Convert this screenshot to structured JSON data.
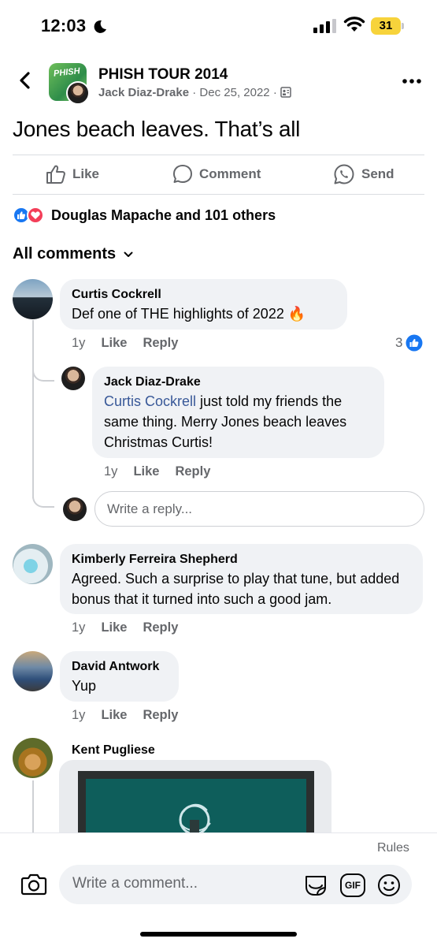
{
  "status_bar": {
    "time": "12:03",
    "battery": "31"
  },
  "post": {
    "group_name": "PHISH TOUR 2014",
    "group_avatar_text": "PHISH",
    "author": "Jack Diaz-Drake",
    "date": "Dec 25, 2022",
    "meta_sep": "·",
    "text": "Jones beach leaves. That’s all"
  },
  "actions": {
    "like": "Like",
    "comment": "Comment",
    "send": "Send"
  },
  "reactions": {
    "summary": "Douglas Mapache and 101 others"
  },
  "sort": {
    "label": "All comments"
  },
  "comments": [
    {
      "name": "Curtis Cockrell",
      "text": "Def one of THE highlights of 2022 🔥",
      "time": "1y",
      "like": "Like",
      "reply": "Reply",
      "reaction_count": "3"
    },
    {
      "name": "Jack Diaz-Drake",
      "mention": "Curtis Cockrell",
      "text": " just told my friends the same thing. Merry Jones beach leaves Christmas Curtis!",
      "time": "1y",
      "like": "Like",
      "reply": "Reply"
    },
    {
      "name": "Kimberly Ferreira Shepherd",
      "text": "Agreed. Such a surprise to play that tune, but added bonus that it turned into such a good jam.",
      "time": "1y",
      "like": "Like",
      "reply": "Reply"
    },
    {
      "name": "David Antwork",
      "text": "Yup",
      "time": "1y",
      "like": "Like",
      "reply": "Reply"
    },
    {
      "name": "Kent Pugliese"
    }
  ],
  "reply_input": {
    "placeholder": "Write a reply..."
  },
  "composer": {
    "rules": "Rules",
    "placeholder": "Write a comment...",
    "gif": "GIF"
  },
  "colors": {
    "accent": "#1877f2",
    "mention": "#385898",
    "bubble": "#f0f2f5",
    "secondary_text": "#65676b"
  }
}
